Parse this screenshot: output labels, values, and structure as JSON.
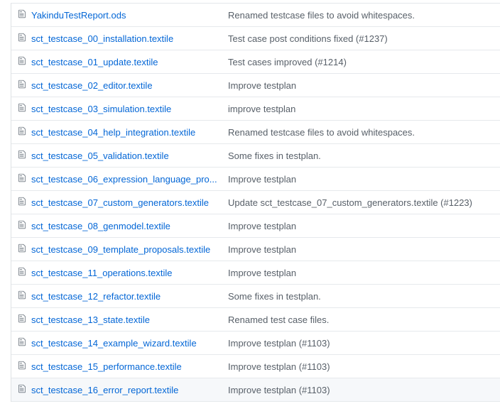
{
  "colors": {
    "link": "#0366d6",
    "message": "#586069",
    "border": "#e6e9ec",
    "icon": "#6a737d"
  },
  "icon_name": "file-text-icon",
  "files": [
    {
      "name": "YakinduTestReport.ods",
      "message": "Renamed testcase files to avoid whitespaces."
    },
    {
      "name": "sct_testcase_00_installation.textile",
      "message": "Test case post conditions fixed (#1237)"
    },
    {
      "name": "sct_testcase_01_update.textile",
      "message": "Test cases improved (#1214)"
    },
    {
      "name": "sct_testcase_02_editor.textile",
      "message": "Improve testplan"
    },
    {
      "name": "sct_testcase_03_simulation.textile",
      "message": "improve testplan"
    },
    {
      "name": "sct_testcase_04_help_integration.textile",
      "message": "Renamed testcase files to avoid whitespaces."
    },
    {
      "name": "sct_testcase_05_validation.textile",
      "message": "Some fixes in testplan."
    },
    {
      "name": "sct_testcase_06_expression_language_pro...",
      "message": "Improve testplan"
    },
    {
      "name": "sct_testcase_07_custom_generators.textile",
      "message": "Update sct_testcase_07_custom_generators.textile (#1223)"
    },
    {
      "name": "sct_testcase_08_genmodel.textile",
      "message": "Improve testplan"
    },
    {
      "name": "sct_testcase_09_template_proposals.textile",
      "message": "Improve testplan"
    },
    {
      "name": "sct_testcase_11_operations.textile",
      "message": "Improve testplan"
    },
    {
      "name": "sct_testcase_12_refactor.textile",
      "message": "Some fixes in testplan."
    },
    {
      "name": "sct_testcase_13_state.textile",
      "message": "Renamed test case files."
    },
    {
      "name": "sct_testcase_14_example_wizard.textile",
      "message": "Improve testplan (#1103)"
    },
    {
      "name": "sct_testcase_15_performance.textile",
      "message": "Improve testplan (#1103)"
    },
    {
      "name": "sct_testcase_16_error_report.textile",
      "message": "Improve testplan (#1103)"
    }
  ]
}
